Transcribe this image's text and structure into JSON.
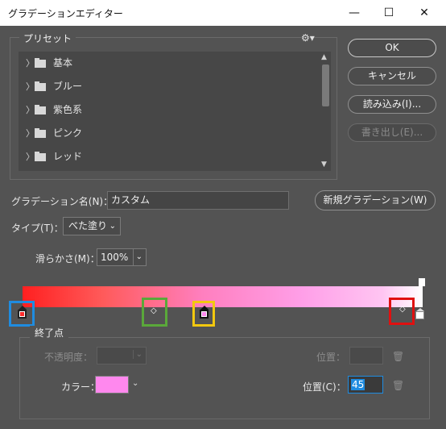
{
  "window": {
    "title": "グラデーションエディター",
    "min": "—",
    "max": "☐",
    "close": "✕"
  },
  "preset": {
    "legend": "プリセット",
    "items": [
      "基本",
      "ブルー",
      "紫色系",
      "ピンク",
      "レッド"
    ]
  },
  "buttons": {
    "ok": "OK",
    "cancel": "キャンセル",
    "load": "読み込み(I)...",
    "export": "書き出し(E)...",
    "new": "新規グラデーション(W)"
  },
  "name": {
    "label": "グラデーション名(N)：",
    "value": "カスタム"
  },
  "type": {
    "label": "タイプ(T)：",
    "value": "べた塗り"
  },
  "smooth": {
    "label": "滑らかさ(M)：",
    "value": "100%"
  },
  "stops": {
    "legend": "終了点",
    "opacity_label": "不透明度：",
    "position_label": "位置：",
    "color_label": "カラー：",
    "color_value": "#ff88ee",
    "position_c_label": "位置(C)：",
    "position_c_value": "45"
  },
  "colors": {
    "bg": "#535353",
    "highlight_blue": "#1f8ce0",
    "highlight_green": "#5aa83a",
    "highlight_yellow": "#f2c80f",
    "highlight_red": "#e01010"
  }
}
